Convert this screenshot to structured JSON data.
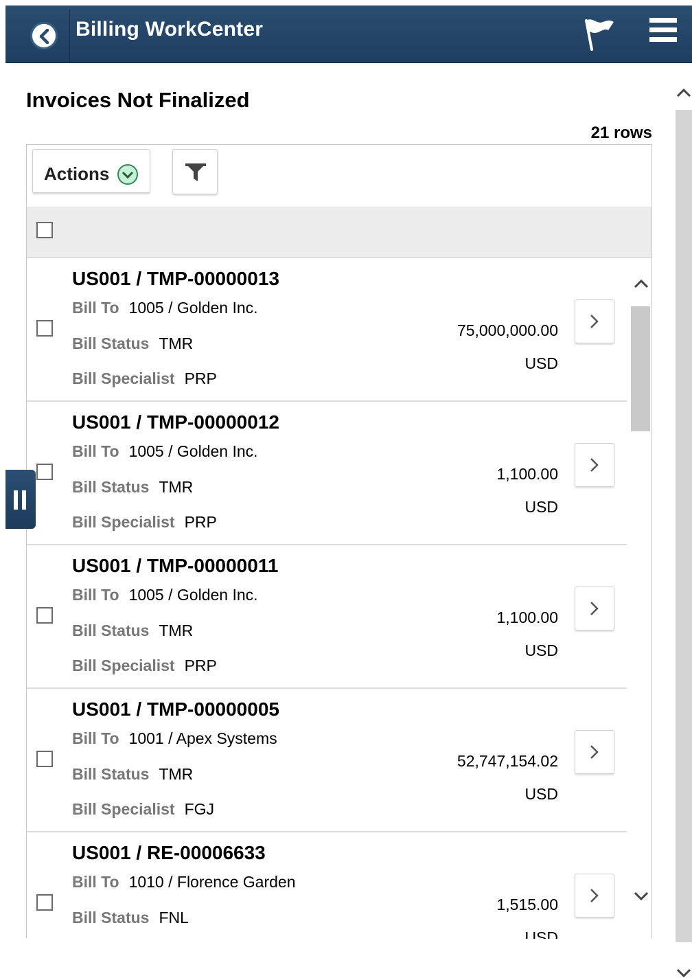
{
  "header": {
    "title": "Billing WorkCenter",
    "back_icon": "chevron-left-icon",
    "flag_icon": "flag-icon",
    "menu_icon": "hamburger-menu-icon",
    "color": "#244668"
  },
  "section": {
    "title": "Invoices Not Finalized",
    "row_count": "21 rows"
  },
  "toolbar": {
    "actions_label": "Actions",
    "actions_icon": "chevron-down-circle-icon",
    "filter_icon": "filter-icon"
  },
  "labels": {
    "bill_to": "Bill To",
    "bill_status": "Bill Status",
    "bill_specialist": "Bill Specialist"
  },
  "invoices": [
    {
      "id": "US001 / TMP-00000013",
      "bill_to": "1005 / Golden Inc.",
      "status": "TMR",
      "specialist": "PRP",
      "amount": "75,000,000.00",
      "currency": "USD"
    },
    {
      "id": "US001 / TMP-00000012",
      "bill_to": "1005 / Golden Inc.",
      "status": "TMR",
      "specialist": "PRP",
      "amount": "1,100.00",
      "currency": "USD"
    },
    {
      "id": "US001 / TMP-00000011",
      "bill_to": "1005 / Golden Inc.",
      "status": "TMR",
      "specialist": "PRP",
      "amount": "1,100.00",
      "currency": "USD"
    },
    {
      "id": "US001 / TMP-00000005",
      "bill_to": "1001 / Apex Systems",
      "status": "TMR",
      "specialist": "FGJ",
      "amount": "52,747,154.02",
      "currency": "USD"
    },
    {
      "id": "US001 / RE-00006633",
      "bill_to": "1010 / Florence Garden",
      "status": "FNL",
      "specialist": "",
      "amount": "1,515.00",
      "currency": "USD"
    }
  ],
  "colors": {
    "header_bg": "#244668",
    "accent_green": "#3cb371",
    "label_gray": "#777777"
  }
}
